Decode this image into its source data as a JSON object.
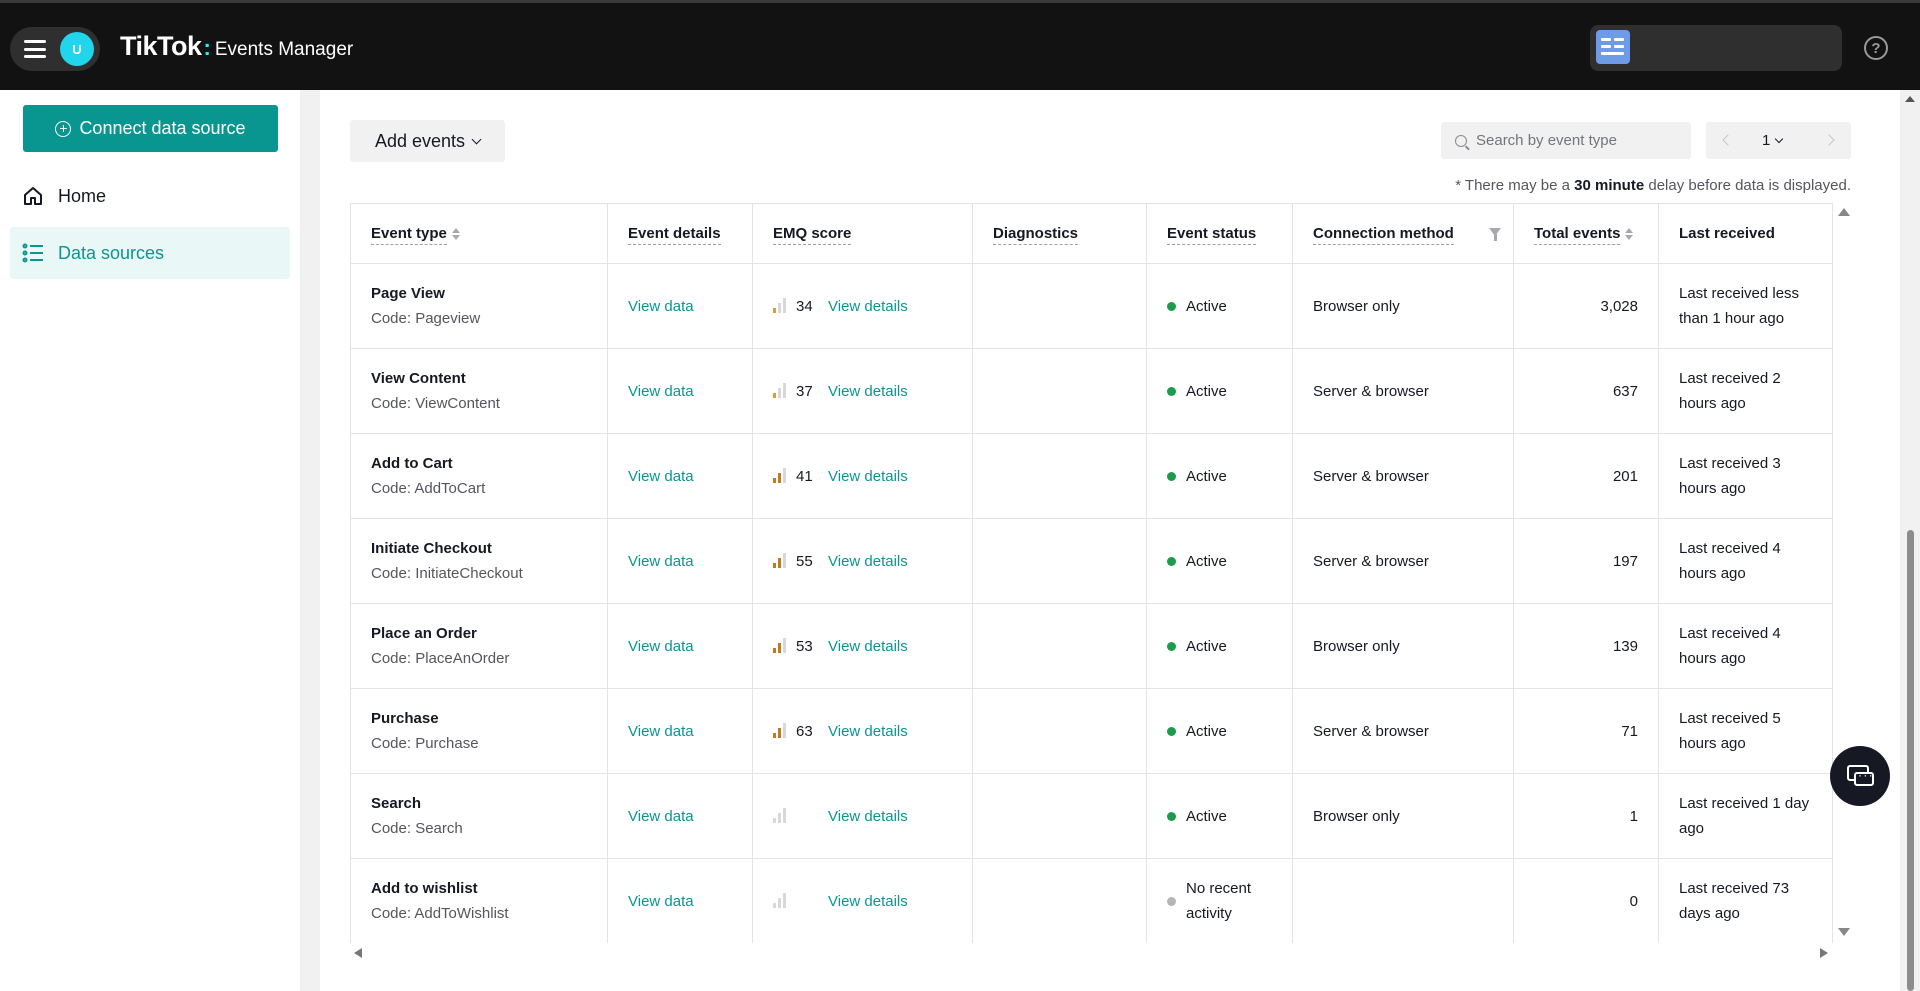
{
  "header": {
    "logo": "TikTok",
    "separator": ":",
    "product": "Events Manager",
    "avatar_initial": "U",
    "help_glyph": "?"
  },
  "sidebar": {
    "connect_label": "Connect data source",
    "items": [
      {
        "label": "Home",
        "icon": "home-icon",
        "active": false
      },
      {
        "label": "Data sources",
        "icon": "list-icon",
        "active": true
      }
    ]
  },
  "toolbar": {
    "add_events_label": "Add events",
    "search_placeholder": "Search by event type",
    "page": "1",
    "delay_prefix": "* There may be a",
    "delay_bold": "30 minute",
    "delay_suffix": "delay before data is displayed."
  },
  "table": {
    "columns": [
      "Event type",
      "Event details",
      "EMQ score",
      "Diagnostics",
      "Event status",
      "Connection method",
      "Total events",
      "Last received"
    ],
    "rows": [
      {
        "name": "Page View",
        "code": "Code: Pageview",
        "details": "View data",
        "emq": "34",
        "emq_level": "poor",
        "emq_link": "View details",
        "diagnostics": "",
        "status": "Active",
        "connection": "Browser only",
        "total": "3,028",
        "last": "Last received less than 1 hour ago"
      },
      {
        "name": "View Content",
        "code": "Code: ViewContent",
        "details": "View data",
        "emq": "37",
        "emq_level": "poor",
        "emq_link": "View details",
        "diagnostics": "",
        "status": "Active",
        "connection": "Server & browser",
        "total": "637",
        "last": "Last received 2 hours ago"
      },
      {
        "name": "Add to Cart",
        "code": "Code: AddToCart",
        "details": "View data",
        "emq": "41",
        "emq_level": "fair",
        "emq_link": "View details",
        "diagnostics": "",
        "status": "Active",
        "connection": "Server & browser",
        "total": "201",
        "last": "Last received 3 hours ago"
      },
      {
        "name": "Initiate Checkout",
        "code": "Code: InitiateCheckout",
        "details": "View data",
        "emq": "55",
        "emq_level": "fair",
        "emq_link": "View details",
        "diagnostics": "",
        "status": "Active",
        "connection": "Server & browser",
        "total": "197",
        "last": "Last received 4 hours ago"
      },
      {
        "name": "Place an Order",
        "code": "Code: PlaceAnOrder",
        "details": "View data",
        "emq": "53",
        "emq_level": "fair",
        "emq_link": "View details",
        "diagnostics": "",
        "status": "Active",
        "connection": "Browser only",
        "total": "139",
        "last": "Last received 4 hours ago"
      },
      {
        "name": "Purchase",
        "code": "Code: Purchase",
        "details": "View data",
        "emq": "63",
        "emq_level": "fair",
        "emq_link": "View details",
        "diagnostics": "",
        "status": "Active",
        "connection": "Server & browser",
        "total": "71",
        "last": "Last received 5 hours ago"
      },
      {
        "name": "Search",
        "code": "Code: Search",
        "details": "View data",
        "emq": "",
        "emq_level": "none",
        "emq_link": "View details",
        "diagnostics": "",
        "status": "Active",
        "connection": "Browser only",
        "total": "1",
        "last": "Last received 1 day ago"
      },
      {
        "name": "Add to wishlist",
        "code": "Code: AddToWishlist",
        "details": "View data",
        "emq": "",
        "emq_level": "none",
        "emq_link": "View details",
        "diagnostics": "",
        "status": "No recent activity",
        "connection": "",
        "total": "0",
        "last": "Last received 73 days ago"
      }
    ]
  },
  "colors": {
    "brand_teal": "#0a9690",
    "active_dot": "#1a9c4a",
    "inactive_dot": "#b5b6ba",
    "topbar": "#121212"
  }
}
